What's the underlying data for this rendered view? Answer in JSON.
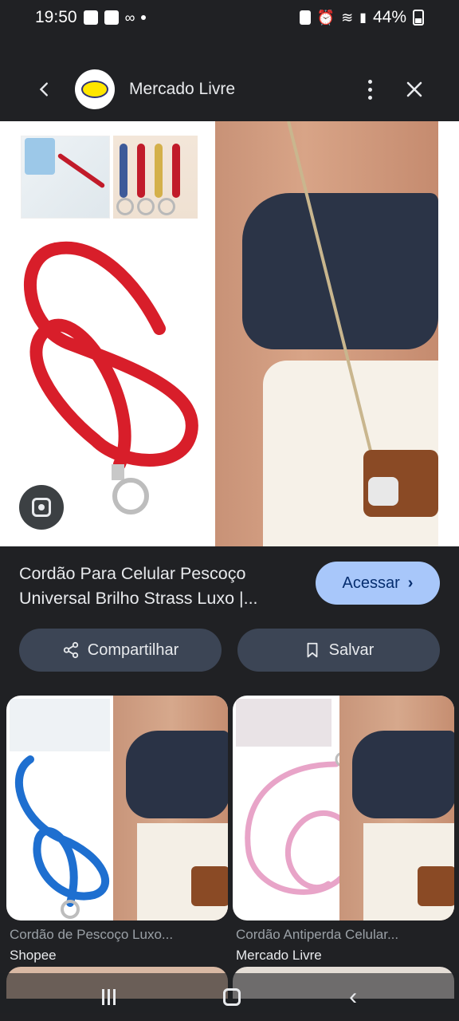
{
  "status_bar": {
    "time": "19:50",
    "battery": "44%"
  },
  "top_bar": {
    "site_name": "Mercado Livre",
    "back_icon": "chevron-left-icon",
    "menu_icon": "more-vert-icon",
    "close_icon": "close-icon"
  },
  "result": {
    "title": "Cordão Para Celular Pescoço Universal Brilho Strass Luxo |...",
    "visit_label": "Acessar"
  },
  "actions": {
    "share_label": "Compartilhar",
    "save_label": "Salvar"
  },
  "related": [
    {
      "title": "Cordão de Pescoço Luxo...",
      "source": "Shopee"
    },
    {
      "title": "Cordão Antiperda Celular...",
      "source": "Mercado Livre"
    }
  ],
  "colors": {
    "background": "#202124",
    "accent_button": "#a8c7fa",
    "pill": "#3c4555",
    "lanyard_red": "#d81e2a",
    "lanyard_blue": "#1e6fd0",
    "lanyard_pink": "#e8a4c8"
  }
}
